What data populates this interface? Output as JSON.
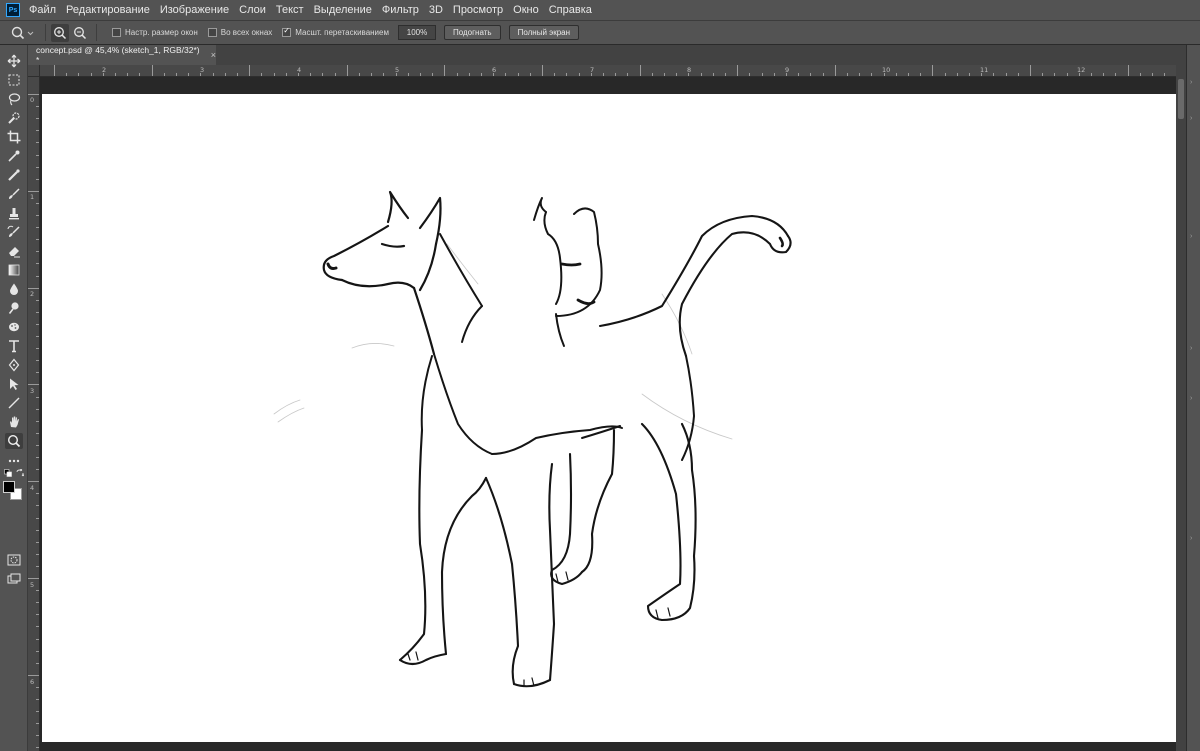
{
  "app": {
    "logo_text": "Ps"
  },
  "menu": [
    "Файл",
    "Редактирование",
    "Изображение",
    "Слои",
    "Текст",
    "Выделение",
    "Фильтр",
    "3D",
    "Просмотр",
    "Окно",
    "Справка"
  ],
  "options": {
    "resize_windows_label": "Настр. размер окон",
    "resize_windows_checked": false,
    "all_windows_label": "Во всех окнах",
    "all_windows_checked": false,
    "scrubby_zoom_label": "Масшт. перетаскиванием",
    "scrubby_zoom_checked": true,
    "zoom_value": "100%",
    "fit_button": "Подогнать",
    "fullscreen_button": "Полный экран"
  },
  "document": {
    "tab_title": "concept.psd @ 45,4% (sketch_1, RGB/32*) *",
    "close_glyph": "×"
  },
  "ruler": {
    "top_numbers": [
      "2",
      "3",
      "4",
      "5",
      "6",
      "7",
      "8",
      "9",
      "10",
      "11",
      "12"
    ],
    "left_numbers": [
      "0",
      "1",
      "2",
      "3",
      "4",
      "5",
      "6"
    ]
  },
  "colors": {
    "foreground": "#000000",
    "background": "#ffffff",
    "ui_gray": "#535353",
    "canvas": "#ffffff"
  },
  "tools": [
    "move-icon",
    "marquee-icon",
    "lasso-icon",
    "quick-select-icon",
    "crop-icon",
    "eyedropper-icon",
    "healing-brush-icon",
    "brush-icon",
    "clone-stamp-icon",
    "history-brush-icon",
    "eraser-icon",
    "gradient-icon",
    "blur-icon",
    "dodge-icon",
    "sponge-icon",
    "type-icon",
    "pen-icon",
    "path-select-icon",
    "line-icon",
    "hand-icon",
    "zoom-icon",
    "more-tools-icon"
  ]
}
